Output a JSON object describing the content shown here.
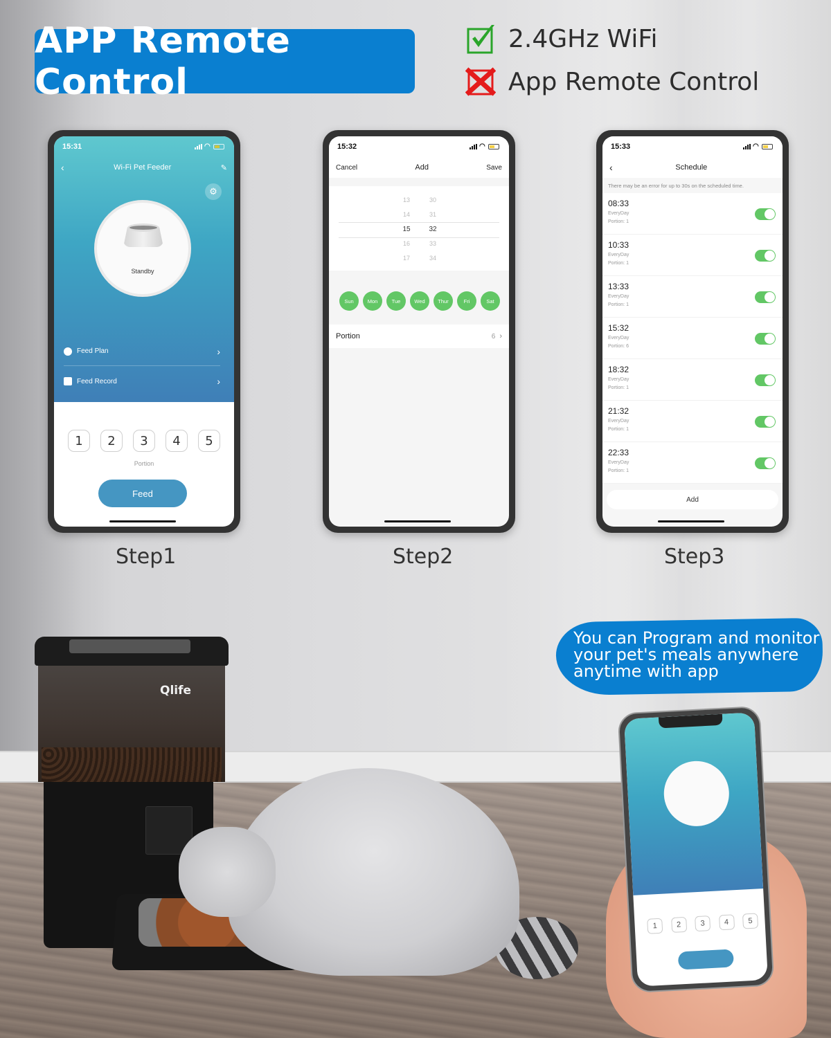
{
  "header": {
    "title": "APP Remote Control",
    "features": [
      {
        "icon": "checkbox-checked-icon",
        "label": "2.4GHz WiFi",
        "color": "#2aa52a"
      },
      {
        "icon": "checkbox-crossed-icon",
        "label": "App Remote Control",
        "color": "#e41b1b"
      }
    ]
  },
  "colors": {
    "brand_blue": "#0a7fd0",
    "toggle_green": "#62c765",
    "feed_button": "#4596c2"
  },
  "step1": {
    "label": "Step1",
    "status_time": "15:31",
    "nav_title": "Wi-Fi Pet Feeder",
    "device_status": "Standby",
    "menu": [
      {
        "icon": "clock-icon",
        "label": "Feed Plan"
      },
      {
        "icon": "record-icon",
        "label": "Feed Record"
      }
    ],
    "portions": [
      "1",
      "2",
      "3",
      "4",
      "5"
    ],
    "portion_label": "Portion",
    "feed_button": "Feed"
  },
  "step2": {
    "label": "Step2",
    "status_time": "15:32",
    "nav": {
      "cancel": "Cancel",
      "title": "Add",
      "save": "Save"
    },
    "picker": {
      "hours": [
        "13",
        "14",
        "15",
        "16",
        "17"
      ],
      "minutes": [
        "30",
        "31",
        "32",
        "33",
        "34"
      ],
      "selected_hour": "15",
      "selected_minute": "32"
    },
    "days": [
      "Sun",
      "Mon",
      "Tue",
      "Wed",
      "Thur",
      "Fri",
      "Sat"
    ],
    "portion_label": "Portion",
    "portion_value": "6"
  },
  "step3": {
    "label": "Step3",
    "status_time": "15:33",
    "nav_title": "Schedule",
    "notice": "There may be an error for up to 30s on the scheduled time.",
    "schedules": [
      {
        "time": "08:33",
        "repeat": "EveryDay",
        "portion": "Portion: 1",
        "enabled": true
      },
      {
        "time": "10:33",
        "repeat": "EveryDay",
        "portion": "Portion: 1",
        "enabled": true
      },
      {
        "time": "13:33",
        "repeat": "EveryDay",
        "portion": "Portion: 1",
        "enabled": true
      },
      {
        "time": "15:32",
        "repeat": "EveryDay",
        "portion": "Portion: 6",
        "enabled": true
      },
      {
        "time": "18:32",
        "repeat": "EveryDay",
        "portion": "Portion: 1",
        "enabled": true
      },
      {
        "time": "21:32",
        "repeat": "EveryDay",
        "portion": "Portion: 1",
        "enabled": true
      },
      {
        "time": "22:33",
        "repeat": "EveryDay",
        "portion": "Portion: 1",
        "enabled": true
      }
    ],
    "add_button": "Add"
  },
  "bubble": {
    "lines": [
      "You can Program and monitor",
      "your pet's meals anywhere",
      "anytime with app"
    ]
  },
  "product": {
    "brand": "Qlife"
  },
  "hand_phone": {
    "portions": [
      "1",
      "2",
      "3",
      "4",
      "5"
    ]
  }
}
